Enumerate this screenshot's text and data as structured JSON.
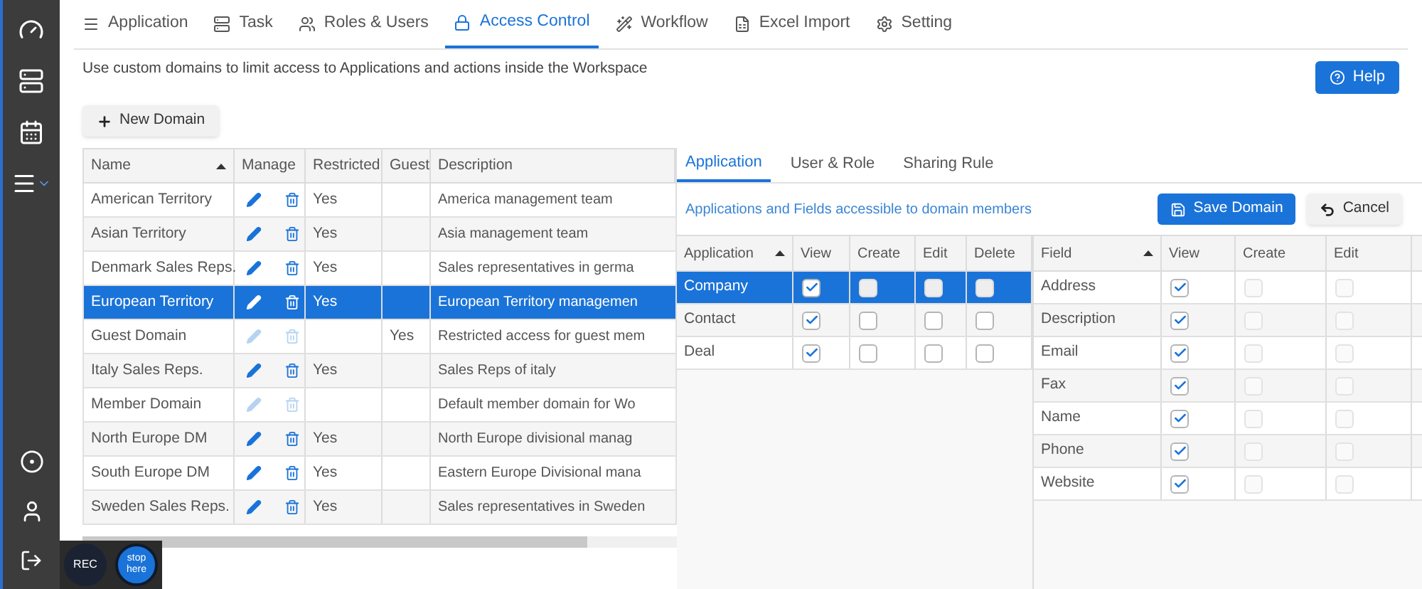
{
  "nav_tabs": [
    {
      "label": "Application",
      "selected": false
    },
    {
      "label": "Task",
      "selected": false
    },
    {
      "label": "Roles & Users",
      "selected": false
    },
    {
      "label": "Access Control",
      "selected": true
    },
    {
      "label": "Workflow",
      "selected": false
    },
    {
      "label": "Excel Import",
      "selected": false
    },
    {
      "label": "Setting",
      "selected": false
    }
  ],
  "intro": "Use custom domains to limit access to Applications and actions inside the Workspace",
  "help_button": "Help",
  "new_domain_button": "New Domain",
  "domains": {
    "columns": [
      "Name",
      "Manage",
      "Restricted",
      "Guest",
      "Description"
    ],
    "rows": [
      {
        "name": "American Territory",
        "manage_disabled": false,
        "restricted": "Yes",
        "description": "America management team",
        "selected": false
      },
      {
        "name": "Asian Territory",
        "manage_disabled": false,
        "restricted": "Yes",
        "description": "Asia management team",
        "selected": false
      },
      {
        "name": "Denmark Sales Reps.",
        "manage_disabled": false,
        "restricted": "Yes",
        "description": "Sales representatives in germa",
        "selected": false
      },
      {
        "name": "European Territory",
        "manage_disabled": false,
        "restricted": "Yes",
        "description": "European Territory managemen",
        "selected": true
      },
      {
        "name": "Guest Domain",
        "manage_disabled": true,
        "guest": "Yes",
        "description": "Restricted access for guest mem",
        "selected": false
      },
      {
        "name": "Italy Sales Reps.",
        "manage_disabled": false,
        "restricted": "Yes",
        "description": "Sales Reps of italy",
        "selected": false
      },
      {
        "name": "Member Domain",
        "manage_disabled": true,
        "description": "Default member domain for Wo",
        "selected": false
      },
      {
        "name": "North Europe DM",
        "manage_disabled": false,
        "restricted": "Yes",
        "description": "North Europe divisional manag",
        "selected": false
      },
      {
        "name": "South Europe DM",
        "manage_disabled": false,
        "restricted": "Yes",
        "description": "Eastern Europe Divisional mana",
        "selected": false
      },
      {
        "name": "Sweden Sales Reps.",
        "manage_disabled": false,
        "restricted": "Yes",
        "description": "Sales representatives in Sweden",
        "selected": false
      }
    ]
  },
  "panel_tabs": [
    {
      "label": "Application",
      "selected": true
    },
    {
      "label": "User & Role",
      "selected": false
    },
    {
      "label": "Sharing Rule",
      "selected": false
    }
  ],
  "caption": "Applications and Fields accessible to domain members",
  "save_button": "Save Domain",
  "cancel_button": "Cancel",
  "applications": {
    "columns": [
      "Application",
      "View",
      "Create",
      "Edit",
      "Delete"
    ],
    "rows": [
      {
        "name": "Company",
        "selected": true,
        "permissions": [
          {
            "checked": true,
            "disabled": false
          },
          {
            "checked": false,
            "disabled": false
          },
          {
            "checked": false,
            "disabled": false
          },
          {
            "checked": false,
            "disabled": false
          }
        ]
      },
      {
        "name": "Contact",
        "selected": false,
        "permissions": [
          {
            "checked": true,
            "disabled": false
          },
          {
            "checked": false,
            "disabled": false
          },
          {
            "checked": false,
            "disabled": false
          },
          {
            "checked": false,
            "disabled": false
          }
        ]
      },
      {
        "name": "Deal",
        "selected": false,
        "permissions": [
          {
            "checked": true,
            "disabled": false
          },
          {
            "checked": false,
            "disabled": false
          },
          {
            "checked": false,
            "disabled": false
          },
          {
            "checked": false,
            "disabled": false
          }
        ]
      }
    ]
  },
  "fields": {
    "columns": [
      "Field",
      "View",
      "Create",
      "Edit"
    ],
    "rows": [
      {
        "name": "Address",
        "permissions": [
          {
            "checked": true,
            "disabled": false
          },
          {
            "checked": false,
            "disabled": true
          },
          {
            "checked": false,
            "disabled": true
          }
        ]
      },
      {
        "name": "Description",
        "permissions": [
          {
            "checked": true,
            "disabled": false
          },
          {
            "checked": false,
            "disabled": true
          },
          {
            "checked": false,
            "disabled": true
          }
        ]
      },
      {
        "name": "Email",
        "permissions": [
          {
            "checked": true,
            "disabled": false
          },
          {
            "checked": false,
            "disabled": true
          },
          {
            "checked": false,
            "disabled": true
          }
        ]
      },
      {
        "name": "Fax",
        "permissions": [
          {
            "checked": true,
            "disabled": false
          },
          {
            "checked": false,
            "disabled": true
          },
          {
            "checked": false,
            "disabled": true
          }
        ]
      },
      {
        "name": "Name",
        "permissions": [
          {
            "checked": true,
            "disabled": false
          },
          {
            "checked": false,
            "disabled": true
          },
          {
            "checked": false,
            "disabled": true
          }
        ]
      },
      {
        "name": "Phone",
        "permissions": [
          {
            "checked": true,
            "disabled": false
          },
          {
            "checked": false,
            "disabled": true
          },
          {
            "checked": false,
            "disabled": true
          }
        ]
      },
      {
        "name": "Website",
        "permissions": [
          {
            "checked": true,
            "disabled": false
          },
          {
            "checked": false,
            "disabled": true
          },
          {
            "checked": false,
            "disabled": true
          }
        ]
      }
    ]
  },
  "recorder": {
    "rec_label": "REC",
    "stop_label": "stop here"
  }
}
